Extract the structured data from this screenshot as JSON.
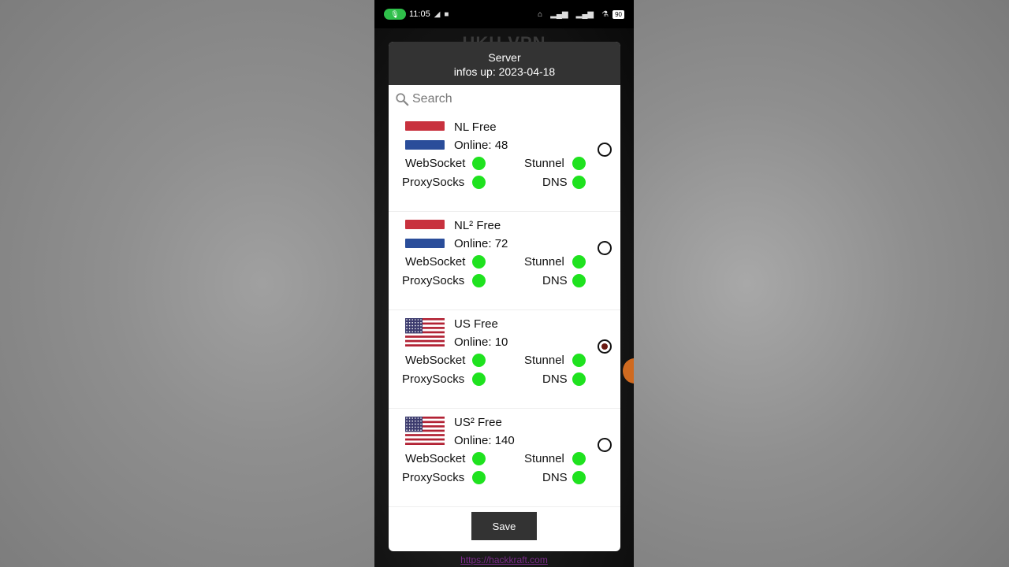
{
  "status_bar": {
    "time": "11:05",
    "battery": "90"
  },
  "background_app": {
    "title": "HKH VPN",
    "link": "https://hackkraft.com"
  },
  "dialog": {
    "title": "Server",
    "subtitle": "infos up: 2023-04-18",
    "search_placeholder": "Search",
    "save_label": "Save",
    "status_color": "#1fe21f",
    "servers": [
      {
        "name": "NL Free",
        "online": "Online: 48",
        "flag": "netherlands-flag",
        "selected": false,
        "protocols": [
          "WebSocket",
          "Stunnel",
          "ProxySocks",
          "DNS"
        ]
      },
      {
        "name": "NL² Free",
        "online": "Online: 72",
        "flag": "netherlands-flag",
        "selected": false,
        "protocols": [
          "WebSocket",
          "Stunnel",
          "ProxySocks",
          "DNS"
        ]
      },
      {
        "name": "US Free",
        "online": "Online: 10",
        "flag": "usa-flag",
        "selected": true,
        "protocols": [
          "WebSocket",
          "Stunnel",
          "ProxySocks",
          "DNS"
        ]
      },
      {
        "name": "US² Free",
        "online": "Online: 140",
        "flag": "usa-flag",
        "selected": false,
        "protocols": [
          "WebSocket",
          "Stunnel",
          "ProxySocks",
          "DNS"
        ]
      }
    ]
  }
}
